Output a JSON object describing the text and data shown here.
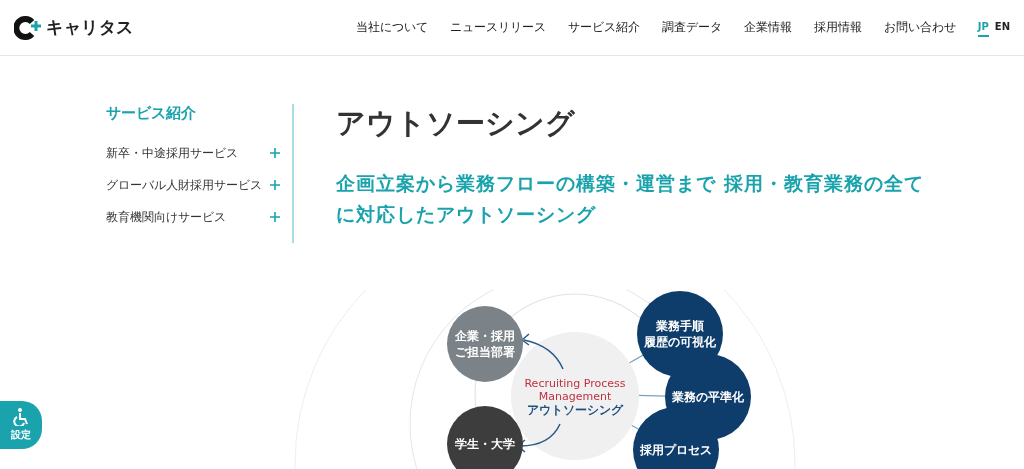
{
  "header": {
    "logo_text": "キャリタス",
    "nav": [
      {
        "label": "当社について"
      },
      {
        "label": "ニュースリリース"
      },
      {
        "label": "サービス紹介"
      },
      {
        "label": "調査データ"
      },
      {
        "label": "企業情報"
      },
      {
        "label": "採用情報"
      },
      {
        "label": "お問い合わせ"
      }
    ],
    "languages": [
      {
        "label": "JP",
        "selected": true
      },
      {
        "label": "EN",
        "selected": false
      }
    ]
  },
  "sidebar": {
    "title": "サービス紹介",
    "items": [
      {
        "label": "新卒・中途採用サービス",
        "expanded": false
      },
      {
        "label": "グローバル人財採用サービス",
        "expanded": false
      },
      {
        "label": "教育機関向けサービス",
        "expanded": false
      }
    ]
  },
  "main": {
    "title": "アウトソーシング",
    "lead": "企画立案から業務フローの構築・運営まで 採用・教育業務の全てに対応したアウトソーシング"
  },
  "diagram": {
    "center_title": [
      "Recruiting Process",
      "Management"
    ],
    "center_subtitle": "アウトソーシング",
    "left_nodes": [
      {
        "lines": [
          "企業・採用",
          "ご担当部署"
        ],
        "color": "#7b8389"
      },
      {
        "lines": [
          "学生・大学"
        ],
        "color": "#3d3d3d"
      }
    ],
    "right_nodes": [
      {
        "lines": [
          "業務手順",
          "履歴の可視化"
        ]
      },
      {
        "lines": [
          "業務の平準化"
        ]
      },
      {
        "lines": [
          "採用プロセス"
        ]
      }
    ]
  },
  "accessibility": {
    "label": "設定"
  }
}
